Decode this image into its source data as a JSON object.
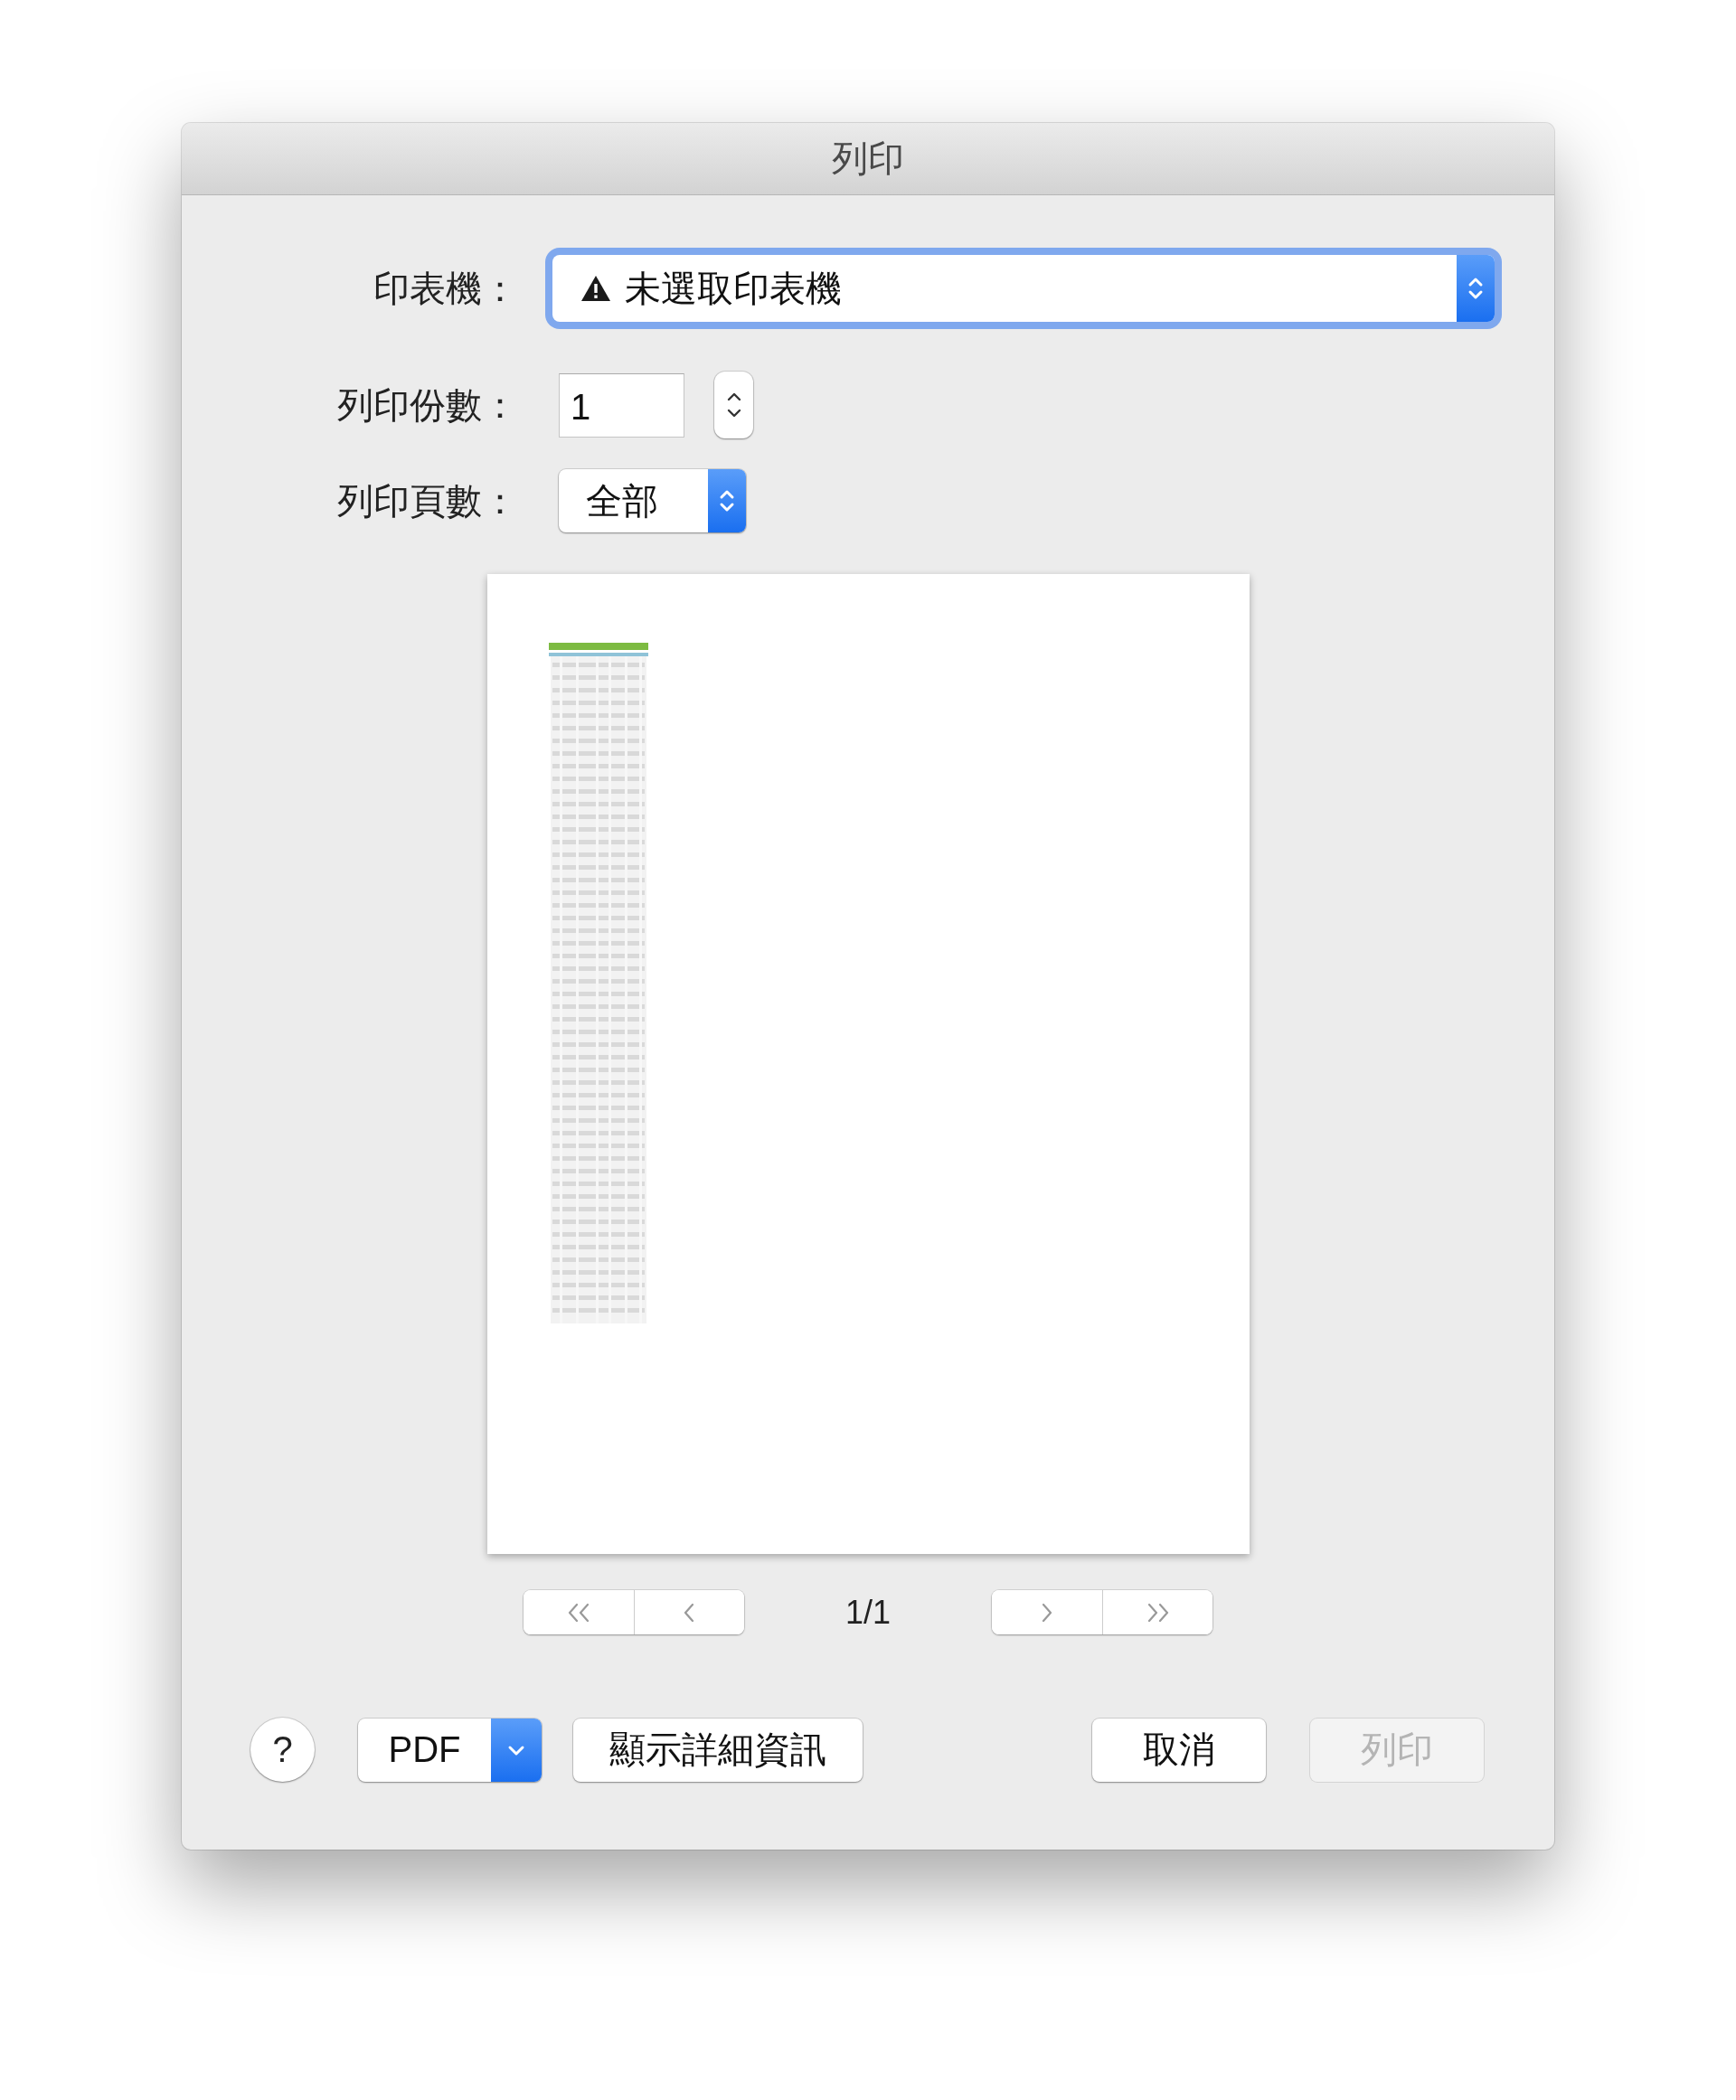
{
  "window": {
    "title": "列印"
  },
  "printer": {
    "label": "印表機：",
    "value": "未選取印表機",
    "warning": true,
    "focused": true
  },
  "copies": {
    "label": "列印份數：",
    "value": "1"
  },
  "pages": {
    "label": "列印頁數：",
    "value": "全部"
  },
  "page_indicator": "1/1",
  "buttons": [
    {
      "kind": "help",
      "label": "?",
      "disabled": false
    },
    {
      "kind": "menu",
      "label": "PDF",
      "disabled": false
    },
    {
      "kind": "push",
      "label": "顯示詳細資訊",
      "disabled": false
    },
    {
      "kind": "spacer"
    },
    {
      "kind": "push",
      "label": "取消",
      "disabled": false
    },
    {
      "kind": "push",
      "label": "列印",
      "disabled": true
    }
  ]
}
